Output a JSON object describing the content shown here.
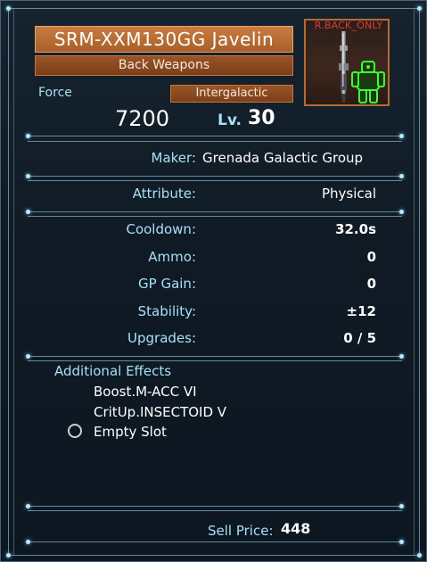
{
  "item": {
    "name": "SRM-XXM130GG Javelin",
    "category": "Back Weapons",
    "rarity": "Intergalactic",
    "force_label": "Force",
    "force_value": "7200",
    "level_label": "Lv.",
    "level_value": "30",
    "image_tag": "R.BACK_ONLY",
    "weapon_icon": "javelin-launcher-icon",
    "slot_icon": "mech-back-slot-icon"
  },
  "stats": [
    {
      "label": "Maker:",
      "value": "Grenada Galactic Group"
    },
    {
      "label": "Attribute:",
      "value": "Physical"
    },
    {
      "label": "Cooldown:",
      "value": "32.0s"
    },
    {
      "label": "Ammo:",
      "value": "0"
    },
    {
      "label": "GP Gain:",
      "value": "0"
    },
    {
      "label": "Stability:",
      "value": "±12"
    },
    {
      "label": "Upgrades:",
      "value": "0 / 5"
    }
  ],
  "effects": {
    "label": "Additional Effects",
    "items": [
      "Boost.M-ACC VI",
      "CritUp.INSECTOID V",
      "Empty Slot"
    ]
  },
  "sell": {
    "label": "Sell Price:",
    "value": "448"
  },
  "colors": {
    "label_cyan": "#a8e0f5",
    "value_white": "#ffffff",
    "title_orange": "#c77c40",
    "tag_red": "#e03a35",
    "mech_green": "#3dff3a"
  }
}
